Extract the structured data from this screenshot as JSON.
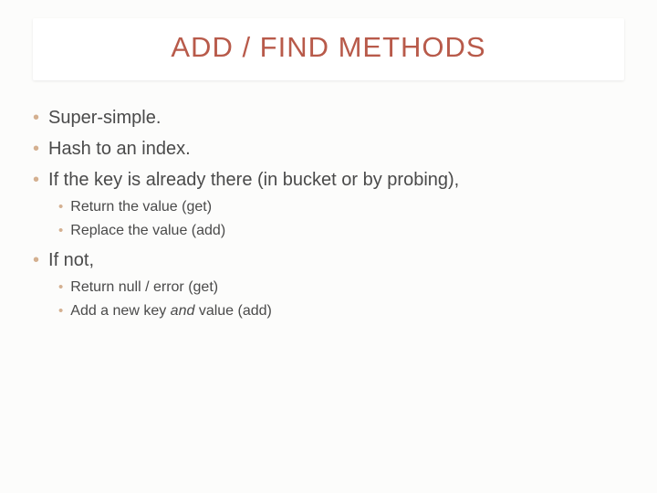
{
  "title": "ADD / FIND METHODS",
  "bullets": [
    {
      "text": "Super-simple."
    },
    {
      "text": "Hash to an index."
    },
    {
      "text": "If the key is already there (in bucket or by probing),",
      "sub": [
        "Return the value (get)",
        "Replace the value (add)"
      ]
    },
    {
      "text": "If not,",
      "sub": [
        "Return null / error (get)"
      ],
      "sub_special": {
        "prefix": "Add a new key ",
        "ital": "and",
        "suffix": " value (add)"
      }
    }
  ]
}
